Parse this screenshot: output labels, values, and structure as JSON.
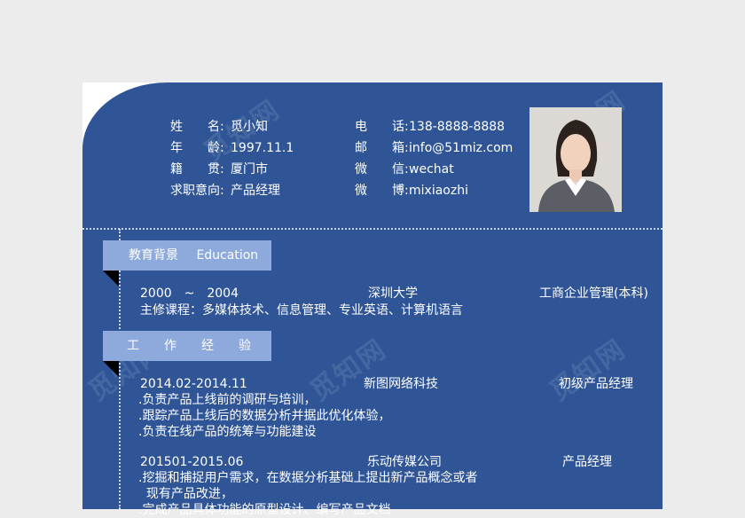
{
  "watermark": "觅知网",
  "profile": {
    "name_label": "姓　　名:",
    "name": "觅小知",
    "age_label": "年　　龄:",
    "birth": "1997.11.1",
    "origin_label": "籍　　贯:",
    "origin": "厦门市",
    "intent_label": "求职意向:",
    "intent": "产品经理",
    "phone_label": "电　　话:",
    "phone": "138-8888-8888",
    "email_label": "邮　　箱:",
    "email": "info@51miz.com",
    "wechat_label": "微　　信:",
    "wechat": "wechat",
    "weibo_label": "微　　博:",
    "weibo": "mixiaozhi"
  },
  "education": {
    "title": "教育背景",
    "title_en": "Education",
    "period": "2000　~　2004",
    "school": "深圳大学",
    "major": "工商企业管理(本科)",
    "courses": "主修课程：多媒体技术、信息管理、专业英语、计算机语言"
  },
  "work": {
    "title": "工　　作　　经　　验",
    "jobs": [
      {
        "period": "2014.02-2014.11",
        "company": "新图网络科技",
        "role": "初级产品经理",
        "lines": [
          ".负责产品上线前的调研与培训，",
          ".跟踪产品上线后的数据分析并据此优化体验，",
          ".负责在线产品的统筹与功能建设"
        ]
      },
      {
        "period": "201501-2015.06",
        "company": "乐动传媒公司",
        "role": "产品经理",
        "lines": [
          ".挖掘和捕捉用户需求，在数据分析基础上提出新产品概念或者",
          "  现有产品改进，",
          ".完成产品具体功能的原型设计、编写产品文档"
        ]
      }
    ]
  },
  "colors": {
    "panel": "#2f5597",
    "section_bar": "#8ea9db",
    "background": "#ececec"
  }
}
